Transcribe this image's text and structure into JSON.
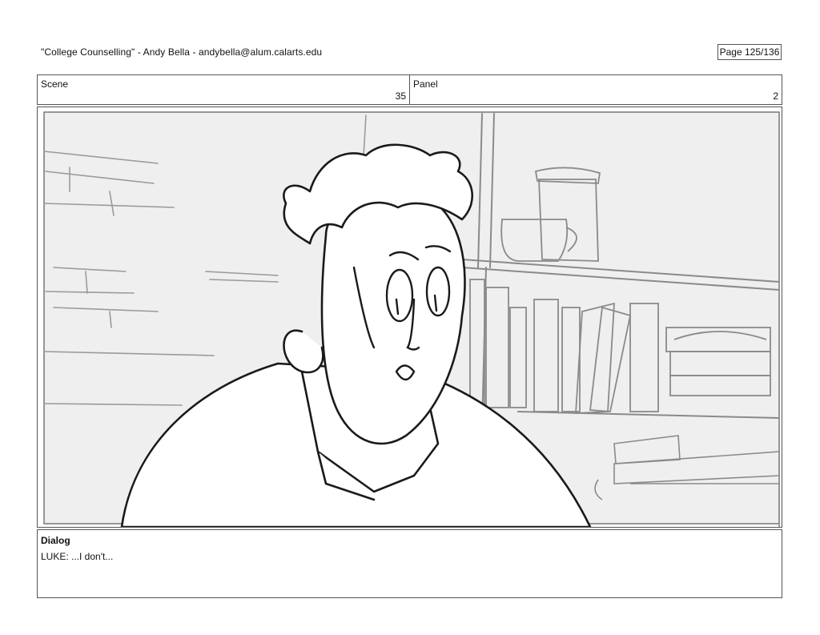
{
  "header": {
    "title": "\"College Counselling\"  -  Andy Bella  -   andybella@alum.calarts.edu",
    "page": "Page 125/136"
  },
  "scene": {
    "label": "Scene",
    "value": "35"
  },
  "panel": {
    "label": "Panel",
    "value": "2"
  },
  "dialog": {
    "label": "Dialog",
    "text": "LUKE: ...I don't..."
  },
  "drawing": {
    "subject": "storyboard-sketch",
    "colors": {
      "sketch": "#2a2a2a",
      "background": "#efefef",
      "lines": "#8a8a8a"
    }
  }
}
